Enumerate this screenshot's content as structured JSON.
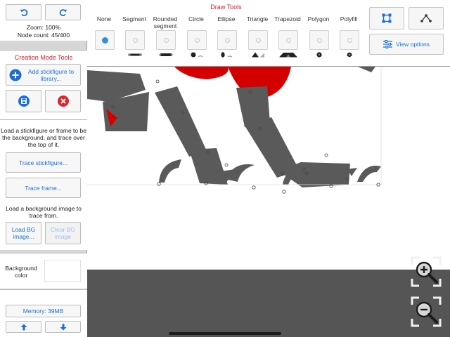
{
  "left_panel": {
    "zoom_text": "Zoom: 100%",
    "node_count_text": "Node count: 45/400",
    "creation_title": "Creation Mode Tools",
    "add_stickfigure_label": "Add stickfigure to library...",
    "trace_info": "Load a stickfigure or frame to be the background, and trace over the top of it.",
    "trace_stickfigure_label": "Trace stickfigure...",
    "trace_frame_label": "Trace frame...",
    "bg_image_info": "Load a background image to trace from.",
    "load_bg_label": "Load BG image...",
    "clear_bg_label": "Clear BG image",
    "bg_color_label": "Background color",
    "bg_color_value": "#ffffff",
    "memory_label": "Memory: 39MB"
  },
  "toolbar": {
    "title": "Draw Tools",
    "tools": [
      {
        "label": "None",
        "selected": true
      },
      {
        "label": "Segment",
        "selected": false
      },
      {
        "label": "Rounded segment",
        "selected": false
      },
      {
        "label": "Circle",
        "selected": false
      },
      {
        "label": "Ellipse",
        "selected": false
      },
      {
        "label": "Triangle",
        "selected": false
      },
      {
        "label": "Trapezoid",
        "selected": false
      },
      {
        "label": "Polygon",
        "selected": false
      },
      {
        "label": "Polyfill",
        "selected": false
      }
    ],
    "view_options_label": "View options"
  },
  "colors": {
    "accent_blue": "#1a6fd6",
    "title_red": "#d61f2b",
    "figure_gray": "#5a5a5a",
    "figure_red": "#d40000",
    "outer_bg": "#555555"
  },
  "icons": {
    "undo": "undo-icon",
    "redo": "redo-icon",
    "add": "plus-circle-icon",
    "save": "floppy-disk-icon",
    "delete": "close-circle-icon",
    "up": "arrow-up-icon",
    "down": "arrow-down-icon",
    "select": "selection-box-icon",
    "nodes": "node-graph-icon",
    "view_options": "sliders-icon",
    "zoom_in": "zoom-in-icon",
    "zoom_out": "zoom-out-icon"
  }
}
